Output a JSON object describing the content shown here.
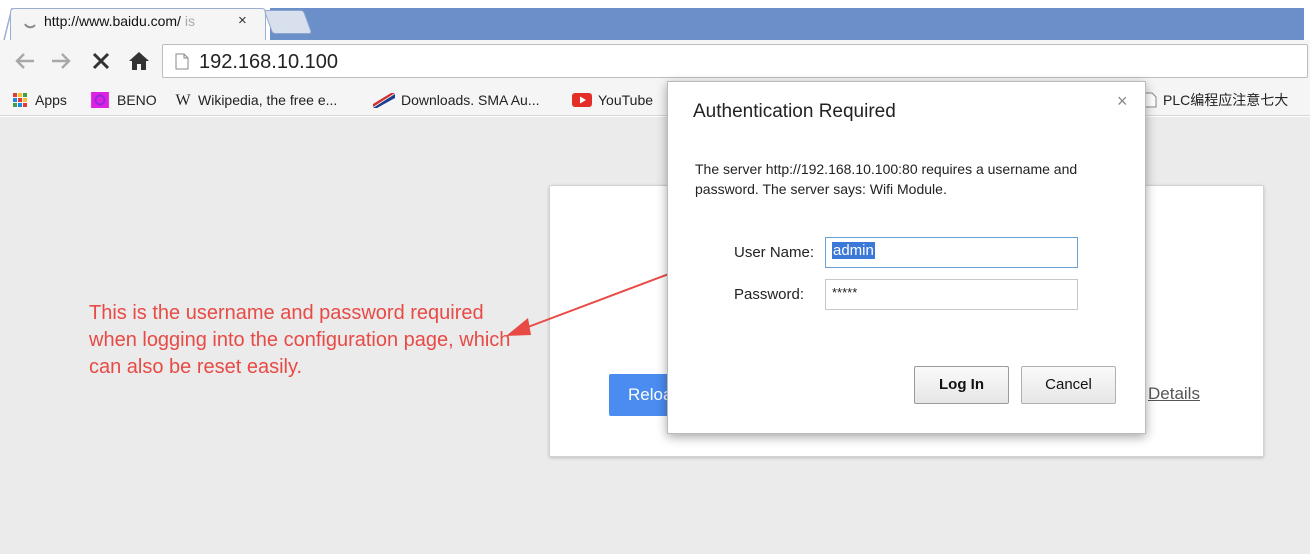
{
  "tab": {
    "title_visible": "http://www.baidu.com/",
    "title_faded": " is",
    "close_glyph": "×"
  },
  "toolbar": {
    "url": "192.168.10.100"
  },
  "bookmarks": [
    {
      "label": "Apps",
      "icon": "apps-grid-icon"
    },
    {
      "label": "BENO",
      "icon": "beno-icon"
    },
    {
      "label": "Wikipedia, the free e...",
      "icon": "wikipedia-icon"
    },
    {
      "label": "Downloads. SMA Au...",
      "icon": "sma-icon"
    },
    {
      "label": "YouTube",
      "icon": "youtube-icon"
    },
    {
      "label": "PLC编程应注意七大",
      "icon": "page-icon"
    }
  ],
  "page": {
    "reload_label": "Reload",
    "details_label": "Details"
  },
  "annotation": {
    "text": "This is the username and password required when logging into the configuration page, which can also be reset easily."
  },
  "dialog": {
    "title": "Authentication Required",
    "message": "The server http://192.168.10.100:80 requires a username and password. The server says: Wifi Module.",
    "username_label": "User Name:",
    "username_value": "admin",
    "password_label": "Password:",
    "password_value": "*****",
    "login_label": "Log In",
    "cancel_label": "Cancel",
    "close_glyph": "×"
  },
  "colors": {
    "annotation": "#e84a45",
    "reload_button": "#4a8cf0",
    "tab_strip": "#6a8fc9"
  }
}
